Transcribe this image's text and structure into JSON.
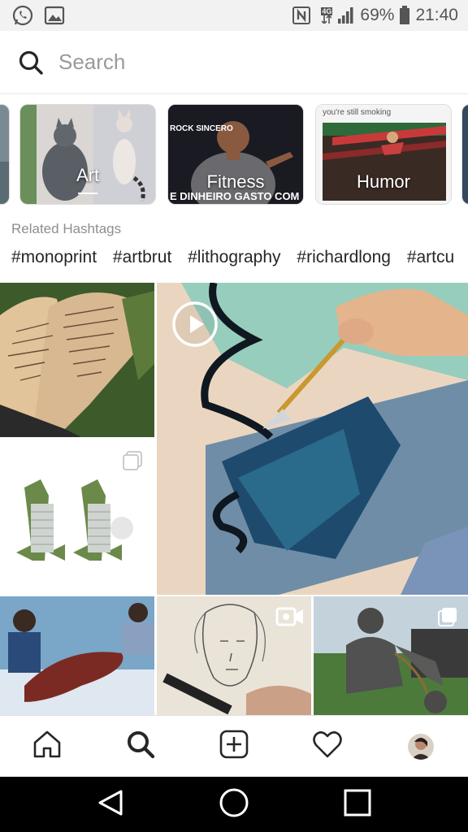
{
  "status_bar": {
    "network": "4G",
    "battery": "69%",
    "time": "21:40"
  },
  "search": {
    "placeholder": "Search"
  },
  "topics": [
    {
      "label": "Art",
      "active": true
    },
    {
      "label": "Fitness",
      "active": false,
      "image_text_top": "ROCK SINCERO",
      "image_text_bottom": "E DINHEIRO GASTO COM"
    },
    {
      "label": "Humor",
      "active": false,
      "image_text_top": "you're still smoking"
    }
  ],
  "related_hashtags": {
    "title": "Related Hashtags",
    "items": [
      "#monoprint",
      "#artbrut",
      "#lithography",
      "#richardlong",
      "#artcu"
    ]
  },
  "grid": {
    "items": [
      {
        "name": "legs-with-writing",
        "type": "photo"
      },
      {
        "name": "crocodile-plush",
        "type": "album"
      },
      {
        "name": "palette-knife-painting",
        "type": "video"
      },
      {
        "name": "painting-people",
        "type": "photo"
      },
      {
        "name": "pencil-sketch",
        "type": "video"
      },
      {
        "name": "bronze-statue",
        "type": "album"
      }
    ]
  },
  "bottom_nav": [
    "home",
    "search",
    "add",
    "activity",
    "profile"
  ],
  "colors": {
    "status_bar_bg": "#f2f2f2",
    "text_primary": "#262626",
    "text_secondary": "#8e8e8e",
    "android_nav_bg": "#000000"
  }
}
